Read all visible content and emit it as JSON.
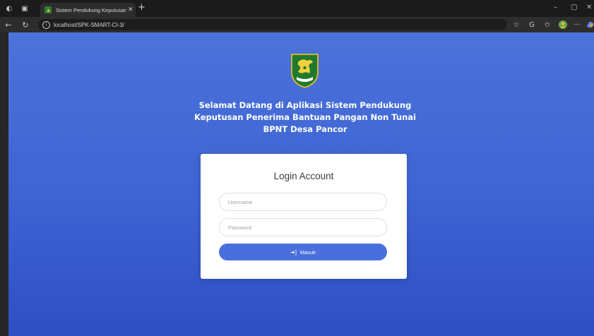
{
  "browser": {
    "tab_title": "Sistem Pendukung Keputusan Pe",
    "url": "localhost/SPK-SMART-CI-3/",
    "window_controls": {
      "minimize": "–",
      "maximize": "▢",
      "close": "✕"
    },
    "icons": {
      "workspace": "workspace-icon",
      "tab_actions": "tab-actions-icon",
      "back": "back-arrow-icon",
      "reload": "reload-icon",
      "site_info": "site-info-icon",
      "favorite": "star-icon",
      "refresh_extension": "extension-icon",
      "favorites": "favorites-icon",
      "profile": "profile-icon",
      "more": "more-icon",
      "copilot": "copilot-icon"
    }
  },
  "page": {
    "welcome_lines": [
      "Selamat Datang di Aplikasi Sistem Pendukung",
      "Keputusan Penerima Bantuan Pangan Non Tunai",
      "BPNT Desa Pancor"
    ],
    "logo": "regency-emblem-logo",
    "login": {
      "title": "Login Account",
      "username_placeholder": "Username",
      "password_placeholder": "Password",
      "submit_label": "Masuk",
      "submit_icon": "sign-in-icon"
    },
    "colors": {
      "background_top": "#4b73da",
      "background_bottom": "#2e4fc4",
      "button": "#4a6fdc"
    }
  }
}
